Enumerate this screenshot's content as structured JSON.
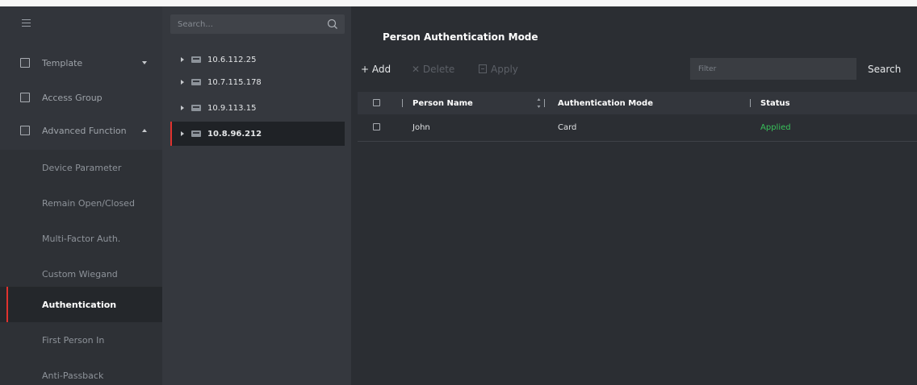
{
  "nav": {
    "items": [
      {
        "label": "Template",
        "icon": "template-icon",
        "caret": "down"
      },
      {
        "label": "Access Group",
        "icon": "lock-icon"
      },
      {
        "label": "Advanced Function",
        "icon": "advanced-function-icon",
        "caret": "up"
      }
    ],
    "sub_items": [
      {
        "label": "Device Parameter"
      },
      {
        "label": "Remain Open/Closed"
      },
      {
        "label": "Multi-Factor Auth."
      },
      {
        "label": "Custom Wiegand"
      },
      {
        "label": "Authentication",
        "active": true
      },
      {
        "label": "First Person In"
      },
      {
        "label": "Anti-Passback"
      }
    ]
  },
  "tree": {
    "search_placeholder": "Search...",
    "devices": [
      {
        "ip": "10.6.112.25"
      },
      {
        "ip": "10.7.115.178"
      },
      {
        "ip": "10.9.113.15"
      },
      {
        "ip": "10.8.96.212",
        "selected": true
      }
    ]
  },
  "main": {
    "title": "Person Authentication Mode",
    "toolbar": {
      "add_label": "+ Add",
      "delete_label": "✕ Delete",
      "apply_label": "Apply",
      "filter_placeholder": "Filter",
      "search_label": "Search"
    },
    "table": {
      "columns": [
        "Person Name",
        "Authentication Mode",
        "Status"
      ],
      "rows": [
        {
          "name": "John",
          "mode": "Card",
          "status": "Applied"
        }
      ]
    }
  },
  "colors": {
    "accent_red": "#e0322e",
    "status_green": "#38c25a",
    "background": "#2b2e33"
  }
}
